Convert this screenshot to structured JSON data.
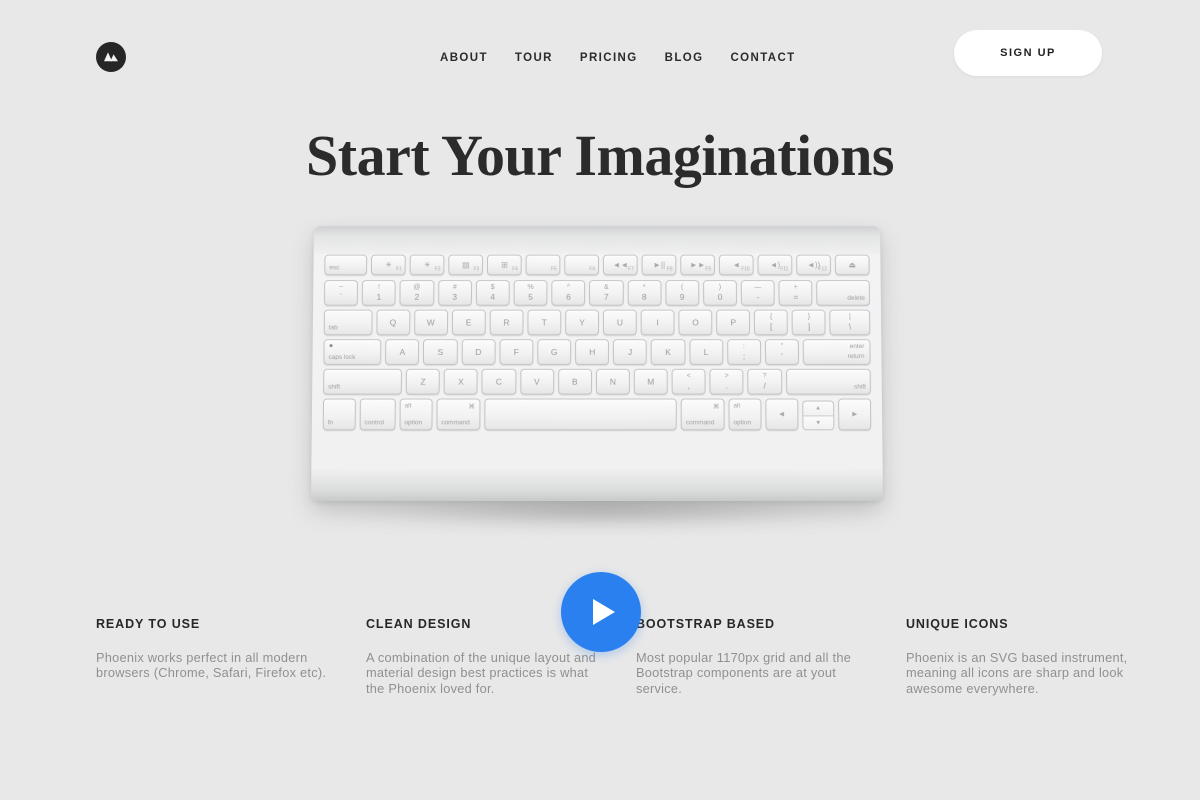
{
  "header": {
    "logo_icon": "mountain-logo-icon",
    "nav": [
      {
        "label": "ABOUT"
      },
      {
        "label": "TOUR"
      },
      {
        "label": "PRICING"
      },
      {
        "label": "BLOG"
      },
      {
        "label": "CONTACT"
      }
    ],
    "signup_label": "SIGN UP"
  },
  "hero": {
    "title": "Start Your Imaginations"
  },
  "media": {
    "play_icon": "play-triangle-icon",
    "device": "apple-wireless-keyboard",
    "keyboard": {
      "fn_row": [
        {
          "label": "esc",
          "pos": "bl",
          "flex": 1.25
        },
        {
          "glyph": "☀",
          "fnum": "F1"
        },
        {
          "glyph": "☀",
          "fnum": "F2"
        },
        {
          "glyph": "▤",
          "fnum": "F3"
        },
        {
          "glyph": "⊞",
          "fnum": "F4"
        },
        {
          "glyph": "",
          "fnum": "F5"
        },
        {
          "glyph": "",
          "fnum": "F6"
        },
        {
          "glyph": "◄◄",
          "fnum": "F7"
        },
        {
          "glyph": "►||",
          "fnum": "F8"
        },
        {
          "glyph": "►►",
          "fnum": "F9"
        },
        {
          "glyph": "◄",
          "fnum": "F10"
        },
        {
          "glyph": "◄)",
          "fnum": "F11"
        },
        {
          "glyph": "◄))",
          "fnum": "F12"
        },
        {
          "glyph": "⏏",
          "fnum": ""
        }
      ],
      "num_row": [
        {
          "top": "~",
          "bot": "`"
        },
        {
          "top": "!",
          "bot": "1"
        },
        {
          "top": "@",
          "bot": "2"
        },
        {
          "top": "#",
          "bot": "3"
        },
        {
          "top": "$",
          "bot": "4"
        },
        {
          "top": "%",
          "bot": "5"
        },
        {
          "top": "^",
          "bot": "6"
        },
        {
          "top": "&",
          "bot": "7"
        },
        {
          "top": "*",
          "bot": "8"
        },
        {
          "top": "(",
          "bot": "9"
        },
        {
          "top": ")",
          "bot": "0"
        },
        {
          "top": "—",
          "bot": "-"
        },
        {
          "top": "+",
          "bot": "="
        },
        {
          "label": "delete",
          "pos": "br",
          "flex": 1.6
        }
      ],
      "q_row": [
        {
          "label": "tab",
          "pos": "bl",
          "flex": 1.45
        },
        {
          "main": "Q"
        },
        {
          "main": "W"
        },
        {
          "main": "E"
        },
        {
          "main": "R"
        },
        {
          "main": "T"
        },
        {
          "main": "Y"
        },
        {
          "main": "U"
        },
        {
          "main": "I"
        },
        {
          "main": "O"
        },
        {
          "main": "P"
        },
        {
          "top": "{",
          "bot": "["
        },
        {
          "top": "}",
          "bot": "]"
        },
        {
          "top": "|",
          "bot": "\\",
          "flex": 1.2
        }
      ],
      "a_row": [
        {
          "label": "caps lock",
          "pos": "bl",
          "caps": true,
          "flex": 1.75
        },
        {
          "main": "A"
        },
        {
          "main": "S"
        },
        {
          "main": "D"
        },
        {
          "main": "F"
        },
        {
          "main": "G"
        },
        {
          "main": "H"
        },
        {
          "main": "J"
        },
        {
          "main": "K"
        },
        {
          "main": "L"
        },
        {
          "top": ":",
          "bot": ";"
        },
        {
          "top": "\"",
          "bot": "'"
        },
        {
          "enter": [
            "enter",
            "return"
          ],
          "flex": 2.05
        }
      ],
      "z_row": [
        {
          "label": "shift",
          "pos": "bl",
          "flex": 2.4
        },
        {
          "main": "Z"
        },
        {
          "main": "X"
        },
        {
          "main": "C"
        },
        {
          "main": "V"
        },
        {
          "main": "B"
        },
        {
          "main": "N"
        },
        {
          "main": "M"
        },
        {
          "top": "<",
          "bot": ","
        },
        {
          "top": ">",
          "bot": "."
        },
        {
          "top": "?",
          "bot": "/"
        },
        {
          "label": "shift",
          "pos": "br",
          "flex": 2.6
        }
      ],
      "bottom_row": [
        {
          "label": "fn",
          "pos": "bl"
        },
        {
          "label": "control",
          "pos": "bl",
          "flex": 1.1
        },
        {
          "label": "option",
          "pos": "bl",
          "alt": "alt"
        },
        {
          "label": "command",
          "pos": "bl",
          "cmd": "⌘",
          "flex": 1.35
        },
        {
          "label": "",
          "space": true,
          "flex": 6.2
        },
        {
          "label": "command",
          "pos": "bl",
          "cmd": "⌘",
          "flex": 1.35
        },
        {
          "label": "option",
          "pos": "bl",
          "alt": "alt"
        },
        {
          "arrowleft": "◄"
        },
        {
          "arrowupdown": [
            "▲",
            "▼"
          ]
        },
        {
          "arrowright": "►"
        }
      ]
    }
  },
  "features": [
    {
      "title": "READY TO USE",
      "body": "Phoenix works perfect in all modern browsers (Chrome, Safari, Firefox etc)."
    },
    {
      "title": "CLEAN DESIGN",
      "body": "A combination of the unique layout and material design best practices is what the Phoenix loved for."
    },
    {
      "title": "BOOTSTRAP BASED",
      "body": "Most popular 1170px grid and all the Bootstrap components are at yout service."
    },
    {
      "title": "UNIQUE ICONS",
      "body": "Phoenix is an SVG based instrument, meaning all icons are sharp and look awesome everywhere."
    }
  ],
  "colors": {
    "page_background": "#e8e8e8",
    "ink": "#2b2b2b",
    "muted_text": "#909090",
    "accent_play": "#2a80ef",
    "logo_background": "#262626",
    "button_background": "#ffffff"
  }
}
